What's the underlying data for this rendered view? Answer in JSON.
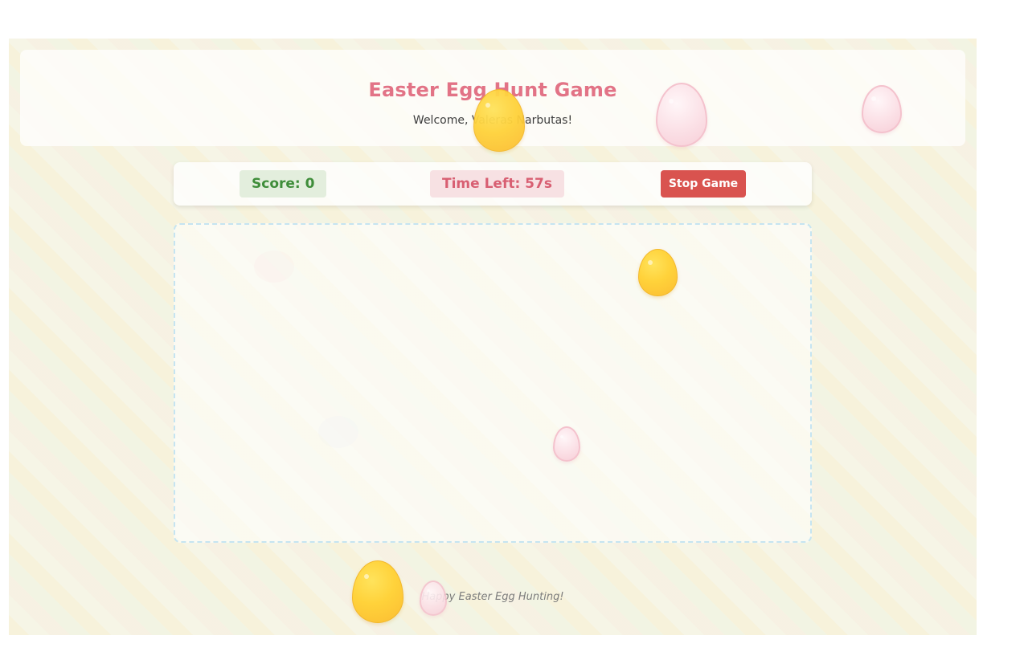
{
  "header": {
    "title": "Easter Egg Hunt Game",
    "welcome": "Welcome, Valeras Narbutas!"
  },
  "controls": {
    "score_label": "Score: 0",
    "time_label": "Time Left: 57s",
    "stop_label": "Stop Game"
  },
  "footer": {
    "text": "Happy Easter Egg Hunting!"
  },
  "colors": {
    "title": "#e27386",
    "score_text": "#3f8d3a",
    "score_bg": "#e3eedd",
    "timer_text": "#d85f72",
    "timer_bg": "#f7e1e3",
    "stop_button": "#d9534f",
    "game_border": "#c5e4f1",
    "egg_yellow": "#ffd23a",
    "egg_pink": "#fbe0e6"
  }
}
